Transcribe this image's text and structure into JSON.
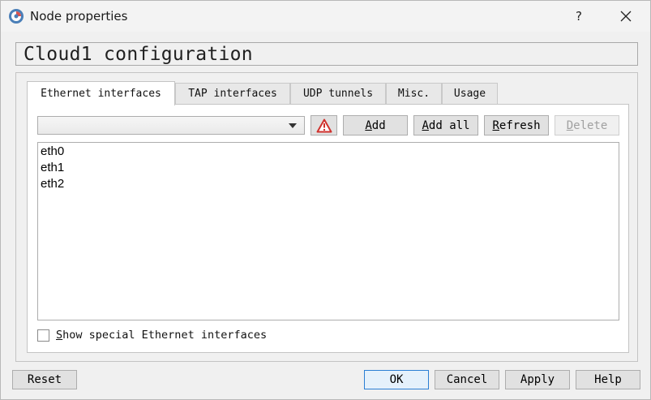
{
  "window": {
    "title": "Node properties",
    "help_label": "?",
    "close_label": "✕",
    "app_icon": "gns3-icon"
  },
  "header": {
    "title": "Cloud1 configuration"
  },
  "tabs": [
    {
      "label": "Ethernet interfaces",
      "active": true
    },
    {
      "label": "TAP interfaces",
      "active": false
    },
    {
      "label": "UDP tunnels",
      "active": false
    },
    {
      "label": "Misc.",
      "active": false
    },
    {
      "label": "Usage",
      "active": false
    }
  ],
  "toolbar": {
    "combo_value": "",
    "warning_icon": "warning-icon",
    "add_rest": "dd",
    "add_mnemonic": "A",
    "addall_mnemonic": "A",
    "addall_rest": "dd all",
    "refresh_mnemonic": "R",
    "refresh_rest": "efresh",
    "delete_mnemonic": "D",
    "delete_rest": "elete"
  },
  "interfaces": [
    "eth0",
    "eth1",
    "eth2"
  ],
  "checkbox": {
    "mnemonic": "S",
    "rest": "how special Ethernet interfaces",
    "checked": false
  },
  "footer": {
    "reset_label": "Reset",
    "ok_label": "OK",
    "cancel_label": "Cancel",
    "apply_label": "Apply",
    "help_label": "Help"
  },
  "colors": {
    "default_button_border": "#2b7fd4",
    "warning": "#d0312d"
  }
}
